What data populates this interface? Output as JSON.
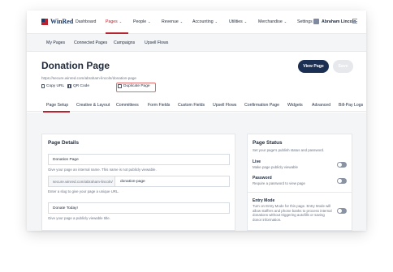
{
  "app": {
    "logo_text": "WinRed"
  },
  "topnav": {
    "items": [
      {
        "label": "Dashboard",
        "has_menu": false
      },
      {
        "label": "Pages",
        "has_menu": true,
        "active": true
      },
      {
        "label": "People",
        "has_menu": true
      },
      {
        "label": "Revenue",
        "has_menu": true
      },
      {
        "label": "Accounting",
        "has_menu": true
      },
      {
        "label": "Utilities",
        "has_menu": true
      },
      {
        "label": "Merchandise",
        "has_menu": true
      },
      {
        "label": "Settings",
        "has_menu": false
      }
    ],
    "chevron": "⌄",
    "user_name": "Abraham Lincoln"
  },
  "subnav": {
    "items": [
      "My Pages",
      "Connected Pages",
      "Campaigns",
      "Upsell Flows"
    ]
  },
  "header": {
    "title": "Donation Page",
    "url": "https://secure.winred.com/abraham-lincoln/donation-page",
    "actions": {
      "copy_url": "Copy URL",
      "qr_code": "QR Code",
      "duplicate": "Duplicate Page"
    },
    "view_button": "View Page",
    "save_button": "Save"
  },
  "tabs": [
    "Page Setup",
    "Creative & Layout",
    "Committees",
    "Form Fields",
    "Custom Fields",
    "Upsell Flows",
    "Confirmation Page",
    "Widgets",
    "Advanced",
    "Bill-Pay Logs"
  ],
  "details": {
    "title": "Page Details",
    "name_value": "Donation Page",
    "name_help": "Give your page an internal name. This name is not publicly viewable.",
    "slug_prefix": "secure.winred.com/abraham-lincoln/",
    "slug_value": "donation-page",
    "slug_help": "Enter a slug to give your page a unique URL.",
    "public_title_value": "Donate Today!",
    "public_title_help": "Give your page a publicly viewable title."
  },
  "status": {
    "title": "Page Status",
    "subtitle": "Set your page's publish status and password.",
    "live_label": "Live",
    "live_desc": "Make page publicly viewable",
    "live_on": false,
    "password_label": "Password",
    "password_desc": "Require a password to view page",
    "password_on": false,
    "entry_label": "Entry Mode",
    "entry_desc": "Turn on Entry Mode for this page. Entry Mode will allow staffers and phone banks to process internal donations without triggering autofills or saving donor information.",
    "entry_on": false
  },
  "colors": {
    "brand_red": "#b7232f",
    "brand_navy": "#1b2f52",
    "highlight": "#e26d6d"
  }
}
